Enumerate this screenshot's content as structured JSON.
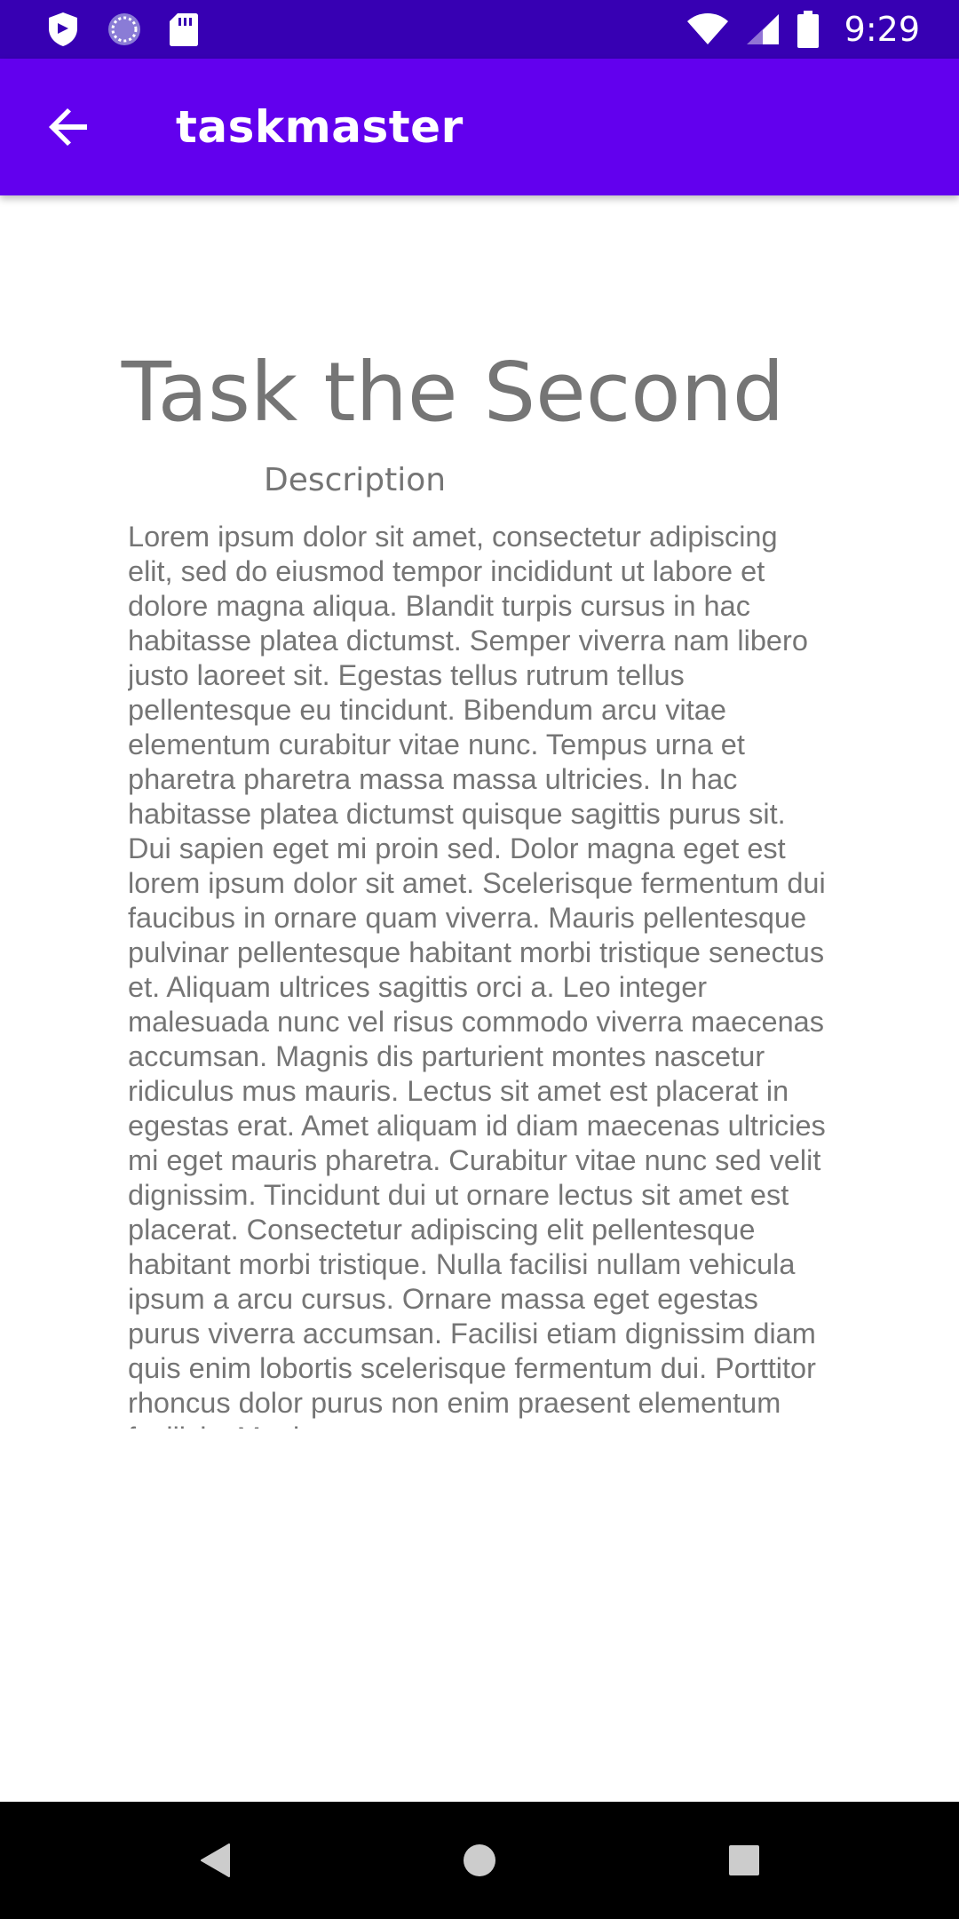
{
  "status_bar": {
    "time": "9:29",
    "icons": [
      "shield-icon",
      "sync-icon",
      "sd-card-icon",
      "wifi-icon",
      "cell-signal-icon",
      "battery-icon"
    ]
  },
  "app_bar": {
    "title": "taskmaster",
    "back_icon": "arrow-back-icon"
  },
  "task": {
    "title": "Task the Second",
    "description_label": "Description",
    "description": "Lorem ipsum dolor sit amet, consectetur adipiscing elit, sed do eiusmod tempor incididunt ut labore et dolore magna aliqua. Blandit turpis cursus in hac habitasse platea dictumst. Semper viverra nam libero justo laoreet sit. Egestas tellus rutrum tellus pellentesque eu tincidunt. Bibendum arcu vitae elementum curabitur vitae nunc. Tempus urna et pharetra pharetra massa massa ultricies. In hac habitasse platea dictumst quisque sagittis purus sit. Dui sapien eget mi proin sed. Dolor magna eget est lorem ipsum dolor sit amet. Scelerisque fermentum dui faucibus in ornare quam viverra. Mauris pellentesque pulvinar pellentesque habitant morbi tristique senectus et. Aliquam ultrices sagittis orci a.  Leo integer malesuada nunc vel risus commodo viverra maecenas accumsan. Magnis dis parturient montes nascetur ridiculus mus mauris. Lectus sit amet est placerat in egestas erat. Amet aliquam id diam maecenas ultricies mi eget mauris pharetra. Curabitur vitae nunc sed velit dignissim. Tincidunt dui ut ornare lectus sit amet est placerat. Consectetur adipiscing elit pellentesque habitant morbi tristique. Nulla facilisi nullam vehicula ipsum a arcu cursus. Ornare massa eget egestas purus viverra accumsan. Facilisi etiam dignissim diam quis enim lobortis scelerisque fermentum dui. Porttitor rhoncus dolor purus non enim praesent elementum facilisis. Mattis"
  },
  "nav_bar": {
    "icons": [
      "back-triangle-icon",
      "home-circle-icon",
      "recents-square-icon"
    ]
  },
  "colors": {
    "status_bar": "#3700b3",
    "app_bar": "#6200ee",
    "text_gray": "#757575",
    "nav_bar": "#000000"
  }
}
